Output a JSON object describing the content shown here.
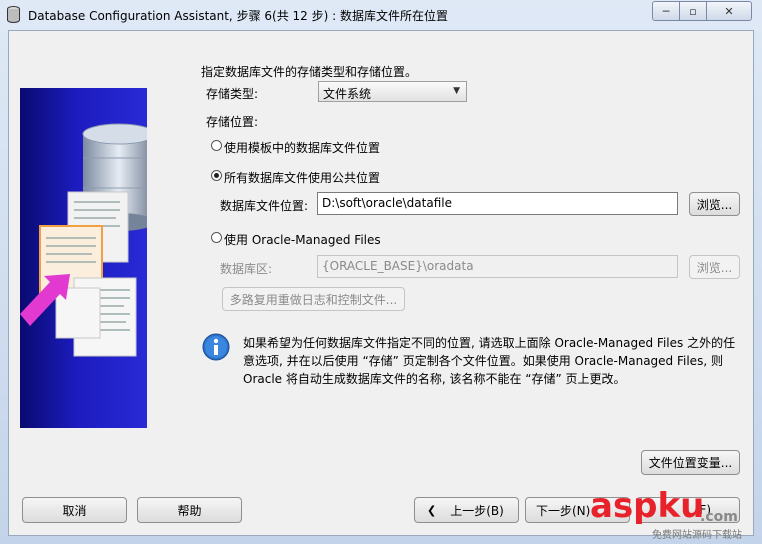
{
  "window": {
    "title": "Database Configuration Assistant, 步骤 6(共 12 步) : 数据库文件所在位置",
    "controls": {
      "minimize": "─",
      "maximize": "▫",
      "close": "✕"
    }
  },
  "form": {
    "heading": "指定数据库文件的存储类型和存储位置。",
    "storage_type_label": "存储类型:",
    "storage_type_value": "文件系统",
    "storage_location_label": "存储位置:",
    "option_template": "使用模板中的数据库文件位置",
    "option_common": "所有数据库文件使用公共位置",
    "db_file_location_label": "数据库文件位置:",
    "db_file_location_value": "D:\\soft\\oracle\\datafile",
    "browse_label": "浏览...",
    "option_omf": "使用 Oracle-Managed Files",
    "db_area_label": "数据库区:",
    "db_area_value": "{ORACLE_BASE}\\oradata",
    "browse2_label": "浏览...",
    "multiplex_label": "多路复用重做日志和控制文件...",
    "info_text": "如果希望为任何数据库文件指定不同的位置, 请选取上面除 Oracle-Managed Files 之外的任意选项, 并在以后使用 “存储” 页定制各个文件位置。如果使用 Oracle-Managed Files, 则 Oracle 将自动生成数据库文件的名称, 该名称不能在 “存储” 页上更改。",
    "file_location_vars_label": "文件位置变量..."
  },
  "footer": {
    "cancel": "取消",
    "help": "帮助",
    "back": "上一步(B)",
    "next": "下一步(N)",
    "finish": "(F)"
  },
  "watermark": {
    "brand": "aspku",
    "suffix": ".com",
    "tagline": "免费网站源码下载站"
  },
  "colors": {
    "frame": "#c9d7ea",
    "client": "#f0f0f0",
    "panel_dark": "#0a0a70",
    "panel_light": "#2a2ad6",
    "watermark": "#e8222a"
  }
}
